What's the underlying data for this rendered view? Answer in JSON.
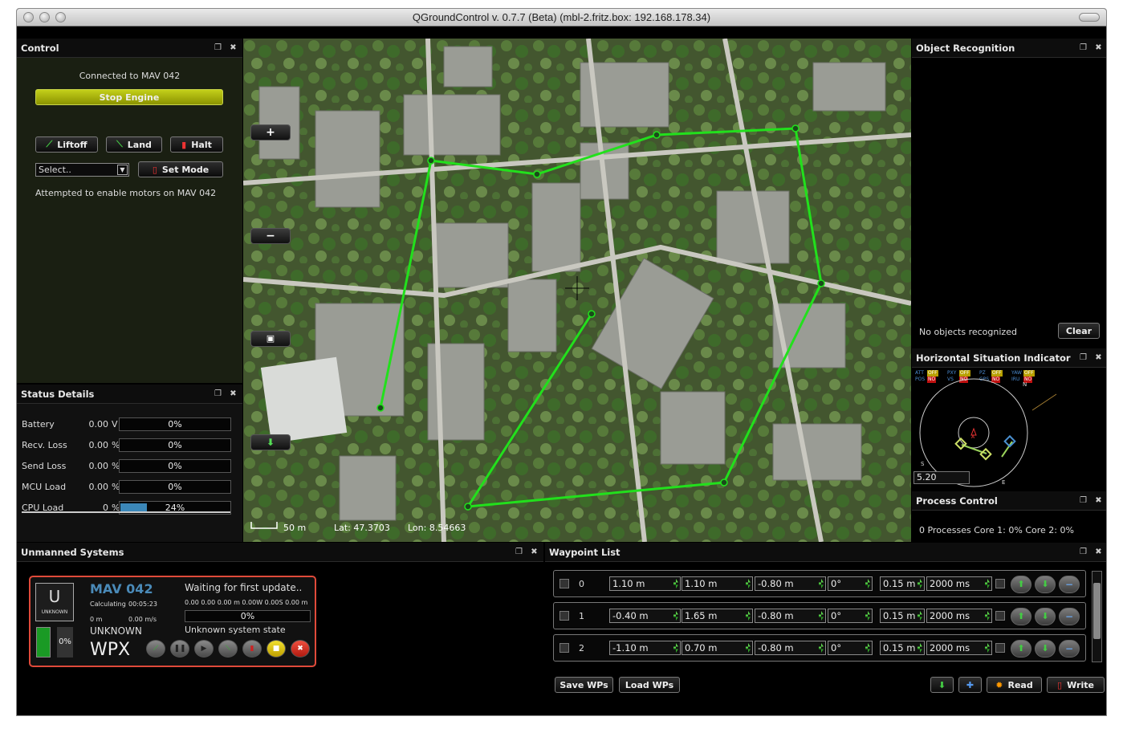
{
  "window": {
    "title": "QGroundControl v. 0.7.7 (Beta) (mbl-2.fritz.box: 192.168.178.34)"
  },
  "control": {
    "title": "Control",
    "connected": "Connected to MAV 042",
    "stop_engine": "Stop Engine",
    "liftoff": "Liftoff",
    "land": "Land",
    "halt": "Halt",
    "mode_select": "Select..",
    "set_mode": "Set Mode",
    "message": "Attempted to enable motors on MAV 042"
  },
  "status_details": {
    "title": "Status Details",
    "rows": [
      {
        "label": "Battery",
        "value": "0.00",
        "unit": "V",
        "bar": "0%",
        "fraction": 0
      },
      {
        "label": "Recv. Loss",
        "value": "0.00",
        "unit": "%",
        "bar": "0%",
        "fraction": 0
      },
      {
        "label": "Send Loss",
        "value": "0.00",
        "unit": "%",
        "bar": "0%",
        "fraction": 0
      },
      {
        "label": "MCU Load",
        "value": "0.00",
        "unit": "%",
        "bar": "0%",
        "fraction": 0
      },
      {
        "label": "CPU Load",
        "value": "0",
        "unit": "%",
        "bar": "24%",
        "fraction": 0.24
      }
    ]
  },
  "map": {
    "scale": "50 m",
    "lat": "Lat: 47.3703",
    "lon": "Lon: 8.54663"
  },
  "object_recognition": {
    "title": "Object Recognition",
    "status": "No objects recognized",
    "clear": "Clear"
  },
  "hsi": {
    "title": "Horizontal Situation Indicator",
    "value": "5.20",
    "flags": [
      "ATT",
      "OFF",
      "PXY",
      "OFF",
      "PZ",
      "OFF",
      "YAW",
      "OFF",
      "POS",
      "NO",
      "VS",
      "NO",
      "GPS",
      "NO",
      "IRU",
      "NO"
    ],
    "compass": {
      "n": "N",
      "e": "E",
      "s": "S"
    },
    "indicator": "A"
  },
  "process_control": {
    "title": "Process Control",
    "status": "0 Processes  Core 1: 0%  Core 2: 0%"
  },
  "unmanned_systems": {
    "title": "Unmanned Systems",
    "icon_letter": "U",
    "type": "UNKNOWN",
    "name": "MAV 042",
    "calc": "Calculating",
    "time": "00:05:23",
    "status": "Waiting for first update..",
    "values": "0.00 0.00 0.00 m  0.00W 0.00S 0.00 m",
    "dist": "0 m",
    "speed": "0.00 m/s",
    "progress": "0%",
    "mode": "UNKNOWN",
    "state": "Unknown system state",
    "battery": "0%",
    "waypoint": "WPX"
  },
  "waypoint_list": {
    "title": "Waypoint List",
    "rows": [
      {
        "id": "0",
        "x": "1.10 m",
        "y": "1.10 m",
        "z": "-0.80 m",
        "yaw": "0°",
        "radius": "0.15 m",
        "hold": "2000 ms"
      },
      {
        "id": "1",
        "x": "-0.40 m",
        "y": "1.65 m",
        "z": "-0.80 m",
        "yaw": "0°",
        "radius": "0.15 m",
        "hold": "2000 ms"
      },
      {
        "id": "2",
        "x": "-1.10 m",
        "y": "0.70 m",
        "z": "-0.80 m",
        "yaw": "0°",
        "radius": "0.15 m",
        "hold": "2000 ms"
      }
    ],
    "save": "Save WPs",
    "load": "Load WPs",
    "read": "Read",
    "write": "Write"
  },
  "colors": {
    "route": "#22e01c",
    "accent_red": "#e04a3a",
    "stop_engine": "#a7b500"
  }
}
